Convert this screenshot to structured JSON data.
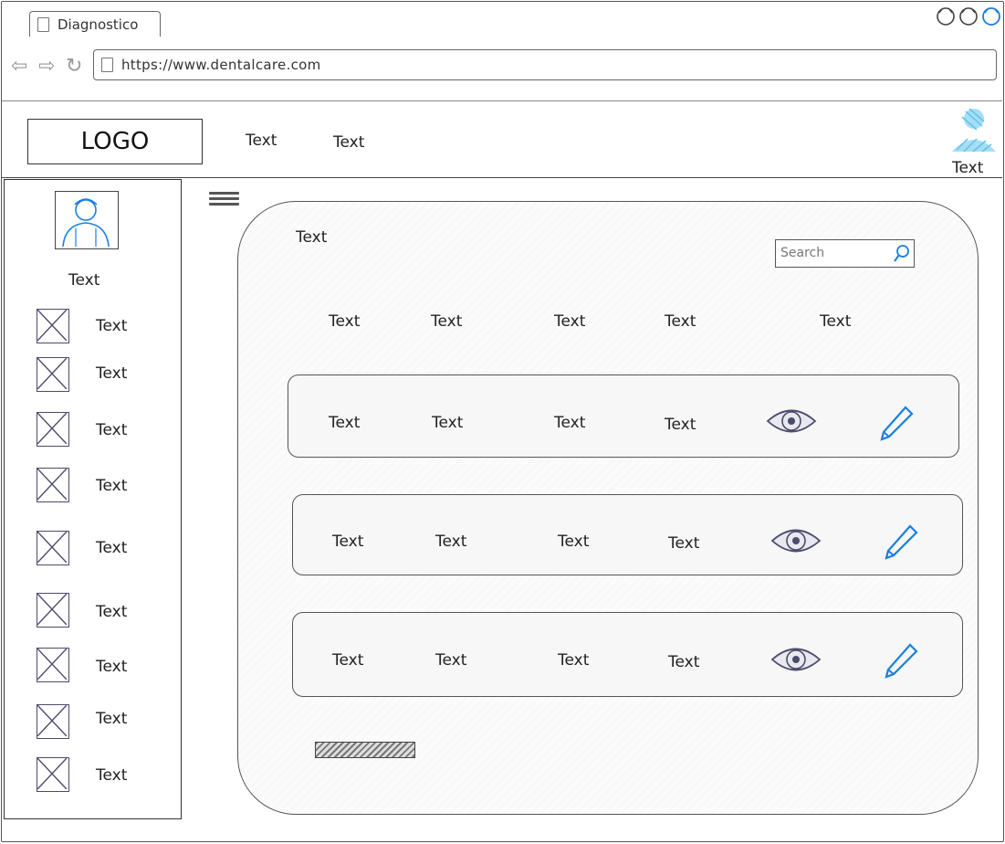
{
  "browser": {
    "tab_title": "Diagnostico",
    "url": "https://www.dentalcare.com"
  },
  "header": {
    "logo_text": "LOGO",
    "nav": [
      "Text",
      "Text"
    ],
    "user_label": "Text"
  },
  "sidebar": {
    "profile_name": "Text",
    "items": [
      {
        "label": "Text"
      },
      {
        "label": "Text"
      },
      {
        "label": "Text"
      },
      {
        "label": "Text"
      },
      {
        "label": "Text"
      },
      {
        "label": "Text"
      },
      {
        "label": "Text"
      },
      {
        "label": "Text"
      },
      {
        "label": "Text"
      }
    ]
  },
  "main": {
    "title": "Text",
    "search_placeholder": "Search",
    "columns": [
      "Text",
      "Text",
      "Text",
      "Text",
      "Text"
    ],
    "rows": [
      {
        "cells": [
          "Text",
          "Text",
          "Text",
          "Text"
        ]
      },
      {
        "cells": [
          "Text",
          "Text",
          "Text",
          "Text"
        ]
      },
      {
        "cells": [
          "Text",
          "Text",
          "Text",
          "Text"
        ]
      }
    ]
  },
  "colors": {
    "accent_blue": "#1a7fe0",
    "frame_gray": "#555555",
    "icon_purple": "#4b4b6b"
  },
  "icons": {
    "window_controls": [
      "minimize-icon",
      "maximize-icon",
      "close-icon"
    ],
    "row_actions": [
      "view-eye-icon",
      "edit-pencil-icon"
    ]
  }
}
